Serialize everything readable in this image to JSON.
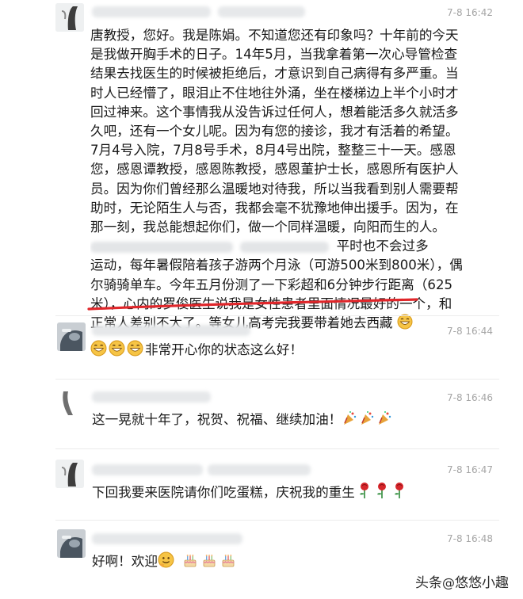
{
  "messages": [
    {
      "time": "7-8 16:42",
      "lines": [
        "唐教授，您好。我是陈娟。不知道您还有印象吗？十年前的今天",
        "是我做开胸手术的日子。14年5月，当我拿着第一次心导管检查",
        "结果去找医生的时候被拒绝后，才意识到自己病得有多严重。当",
        "时人已经懵了，眼泪止不住地往外涌，坐在楼梯边上半个小时才",
        "回过神来。这个事情我从没告诉过任何人，想着能活多久就活多",
        "久吧，还有一个女儿呢。因为有您的接诊，我才有活着的希望。",
        "7月4号入院，7月8号手术，8月4号出院，整整三十一天。感恩",
        "您，感恩谭教授，感恩陈教授，感恩董护士长，感恩所有医护人",
        "员。因为你们曾经那么温暖地对待我，所以当我看到别人需要帮",
        "助时，无论陌生人与否，我都会毫不犹豫地伸出援手。因为，在",
        "那一刻，我总能想起你们，做一个同样温暖，向阳而生的人。"
      ],
      "line_with_blur": "平时也不会过多",
      "lines_after": [
        "运动，每年暑假陪着孩子游两个月泳（可游500米到800米），偶",
        "尔骑骑单车。今年五月份测了一下彩超和6分钟步行距离（625",
        "米），心内的罗俊医生说我是女性患者里面情况最好的一个，和",
        "正常人差别不大了。等女儿高考完我要带着她去西藏"
      ]
    },
    {
      "time": "7-8 16:44",
      "text": "非常开心你的状态这么好！",
      "emoji": [
        "grin-emoji",
        "grin-emoji",
        "grin-emoji"
      ]
    },
    {
      "time": "7-8 16:46",
      "text": "这一晃就十年了，祝贺、祝福、继续加油！",
      "emoji": [
        "party-popper-icon",
        "party-popper-icon",
        "party-popper-icon"
      ]
    },
    {
      "time": "7-8 16:47",
      "text": "下回我要来医院请你们吃蛋糕，庆祝我的重生",
      "emoji": [
        "rose-icon",
        "rose-icon",
        "rose-icon"
      ]
    },
    {
      "time": "7-8 16:48",
      "text": "好啊！欢迎",
      "emoji": [
        "wave-emoji",
        "cake-icon",
        "cake-icon",
        "cake-icon"
      ]
    }
  ],
  "watermark": {
    "prefix": "头条",
    "at": "@",
    "name": "悠悠小趣"
  },
  "colors": {
    "underline": "#e0262a",
    "time": "#a5a5a5",
    "divider": "#ececec"
  }
}
